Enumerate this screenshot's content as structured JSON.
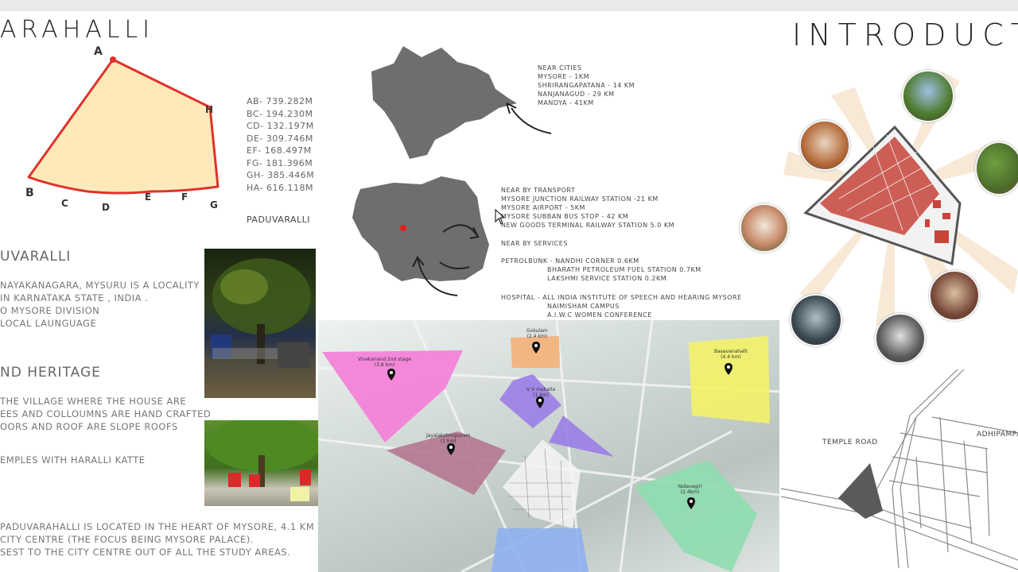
{
  "title_left": "ARAHALLI",
  "title_right": "INTRODUCT",
  "plot": {
    "vertices": [
      "A",
      "B",
      "C",
      "D",
      "E",
      "F",
      "G",
      "H"
    ],
    "measurements": [
      "AB- 739.282m",
      "BC- 194.230m",
      "CD- 132.197m",
      "DE- 309.746m",
      "EF- 168.497m",
      "FG- 181.396m",
      "GH- 385.446m",
      "HA- 616.118m"
    ],
    "name": "PADUVARALLI"
  },
  "near_cities": [
    "NEAR CITIES",
    "MYSORE - 1KM",
    "SHRIRANGAPATANA - 14 KM",
    "NANJANAGUD - 29 KM",
    "MANDYA - 41KM"
  ],
  "near_transport": [
    "NEAR BY TRANSPORT",
    "MYSORE JUNCTION RAILWAY STATION -21 KM",
    "MYSORE AIRPORT - 5KM",
    "MYSORE SUBBAN BUS STOP - 42 KM",
    "NEW GOODS TERMINAL RAILWAY STATION 5.0 KM"
  ],
  "near_services": "NEAR BY SERVICES",
  "petrol": [
    "PETROLBUNK - NANDHI CORNER 0.6KM",
    "BHARATH PETROLEUM FUEL STATION 0.7KM",
    "LAKSHMI SERVICE STATION 0.2KM"
  ],
  "hospital": [
    "HOSPITAL - ALL INDIA INSTITUTE OF SPEECH AND HEARING MYSORE",
    "NAIMISHAM CAMPUS",
    "A.I.W.C WOMEN CONFERENCE"
  ],
  "left_section": {
    "heading1": "UVARALLI",
    "lines1": [
      "NAYAKANAGARA, MYSURU IS A LOCALITY",
      "IN KARNATAKA STATE , INDIA .",
      "O MYSORE DIVISION",
      "LOCAL LAUNGUAGE"
    ],
    "heading2": "ND HERITAGE",
    "lines2": [
      "THE VILLAGE WHERE THE HOUSE ARE",
      "EES AND COLLOUMNS ARE HAND CRAFTED",
      "OORS AND ROOF ARE SLOPE ROOFS"
    ],
    "line3": "EMPLES WITH HARALLI KATTE",
    "lines4": [
      "PADUVARAHALLI IS LOCATED IN THE HEART OF MYSORE, 4.1 KM",
      "CITY CENTRE (THE FOCUS BEING MYSORE PALACE).",
      "SEST TO THE CITY CENTRE OUT OF ALL THE STUDY AREAS."
    ]
  },
  "regions": [
    {
      "name": "Vivekanand 2nd stage",
      "dist": "(3.8 km)",
      "color": "#f47fd9"
    },
    {
      "name": "Gokulam",
      "dist": "(2.4 km)",
      "color": "#f4b27b"
    },
    {
      "name": "V V mohalla",
      "dist": "(1 km)",
      "color": "#9c7fe6"
    },
    {
      "name": "Jayalakshmipuram",
      "dist": "(1 km)",
      "color": "#b47a93"
    },
    {
      "name": "Basavanahalli",
      "dist": "(4.4 km)",
      "color": "#f2f26a"
    },
    {
      "name": "Yadavagiri",
      "dist": "(2.4km)",
      "color": "#8fdcb0"
    }
  ],
  "roads": {
    "temple": "TEMPLE ROAD",
    "adhipampa": "ADHIPAMPA R"
  },
  "colors": {
    "plot_fill": "#fde9b9",
    "plot_line": "#e0322b",
    "map_gray": "#6e6e6e",
    "site_red": "#c7443a"
  }
}
